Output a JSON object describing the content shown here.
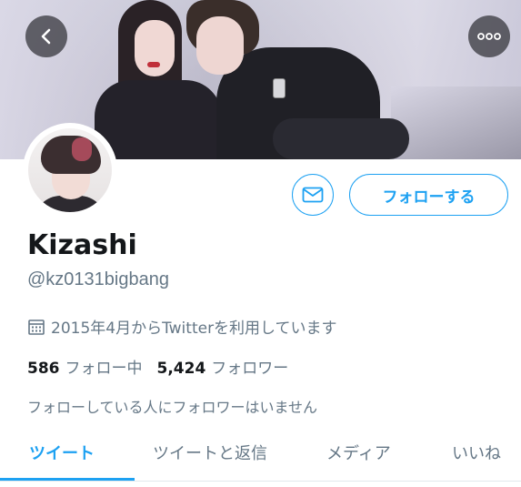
{
  "header": {
    "back_icon": "chevron-left-icon",
    "more_icon": "ellipsis-icon"
  },
  "profile": {
    "display_name": "Kizashi",
    "handle": "@kz0131bigbang",
    "joined_icon": "calendar-icon",
    "joined_text": "2015年4月からTwitterを利用しています",
    "following_count": "586",
    "following_label": "フォロー中",
    "followers_count": "5,424",
    "followers_label": "フォロワー",
    "followed_by_text": "フォローしている人にフォロワーはいません"
  },
  "actions": {
    "message_icon": "envelope-icon",
    "follow_label": "フォローする"
  },
  "tabs": [
    {
      "label": "ツイート",
      "active": true
    },
    {
      "label": "ツイートと返信",
      "active": false
    },
    {
      "label": "メディア",
      "active": false
    },
    {
      "label": "いいね",
      "active": false
    }
  ],
  "colors": {
    "accent": "#1da1f2",
    "text_primary": "#14171a",
    "text_secondary": "#657786"
  }
}
